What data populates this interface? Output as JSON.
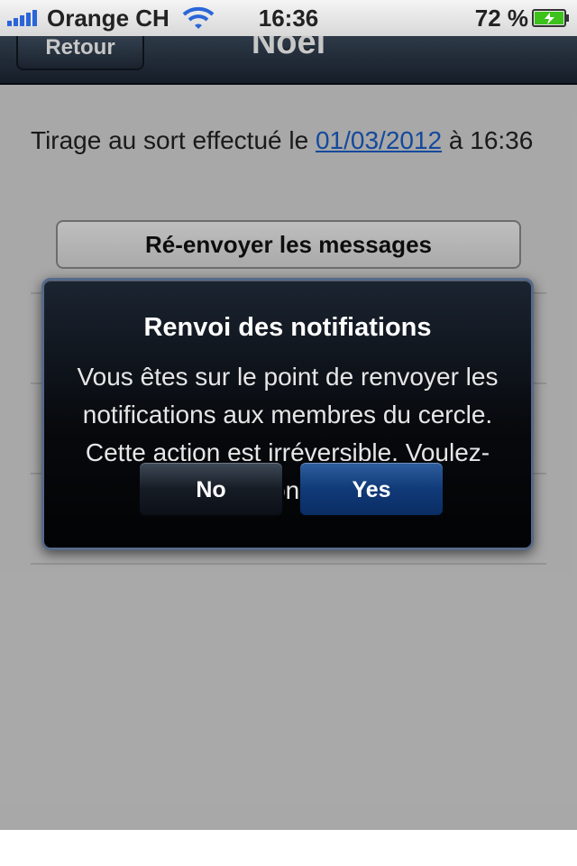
{
  "status_bar": {
    "carrier": "Orange CH",
    "time": "16:36",
    "battery_percent": "72 %",
    "icons": [
      "signal-icon",
      "wifi-icon",
      "battery-charging-icon"
    ]
  },
  "navbar": {
    "back_label": "Retour",
    "title": "Noël"
  },
  "content": {
    "draw_text_prefix": "Tirage au sort effectué le ",
    "draw_date_link": "01/03/2012",
    "draw_text_suffix": " à 16:36",
    "resend_button": "Ré-envoyer les messages"
  },
  "alert": {
    "title": "Renvoi des notifiations",
    "message": "Vous êtes sur le point de renvoyer les notifications aux membres du cercle. Cette action est irréversible. Voulez-vous continuer?",
    "no_label": "No",
    "yes_label": "Yes"
  },
  "colors": {
    "link": "#1a5ec8",
    "navbar": "#1c2634",
    "alert_bg": "#07090d",
    "yes_button": "#103a78",
    "battery_fill": "#3cc21a"
  }
}
